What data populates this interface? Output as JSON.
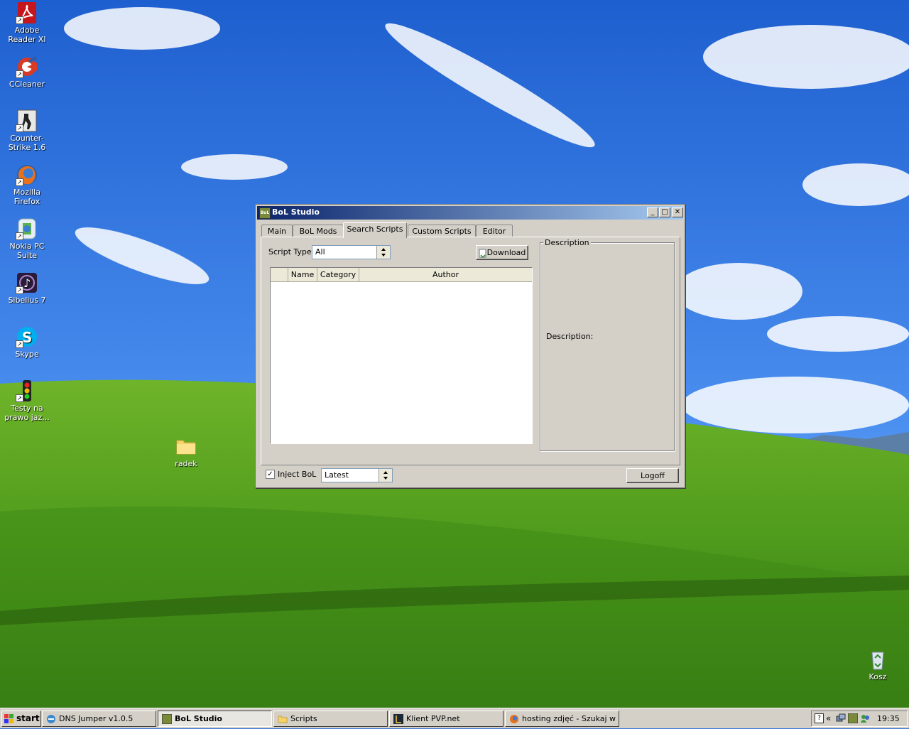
{
  "desktop": {
    "icons": [
      {
        "label": "Adobe Reader XI"
      },
      {
        "label": "CCleaner"
      },
      {
        "label": "Counter-Strike 1.6"
      },
      {
        "label": "Mozilla Firefox"
      },
      {
        "label": "Nokia PC Suite"
      },
      {
        "label": "Sibelius 7"
      },
      {
        "label": "Skype"
      },
      {
        "label": "Testy na prawo jaz..."
      },
      {
        "label": "radek"
      },
      {
        "label": "Kosz"
      }
    ]
  },
  "window": {
    "title": "BoL Studio",
    "title_icon_text": "BoL",
    "controls": {
      "minimize": "_",
      "maximize": "□",
      "close": "✕"
    },
    "tabs": [
      {
        "label": "Main"
      },
      {
        "label": "BoL Mods"
      },
      {
        "label": "Search Scripts",
        "active": true
      },
      {
        "label": "Custom Scripts"
      },
      {
        "label": "Editor"
      }
    ],
    "script_type_label": "Script Type:",
    "script_type_value": "All",
    "download_label": "Download",
    "columns": [
      "",
      "Name",
      "Category",
      "Author"
    ],
    "description_group_label": "Description",
    "description_label": "Description:",
    "inject_label": "Inject BoL",
    "inject_checked": true,
    "version_value": "Latest",
    "logoff_label": "Logoff"
  },
  "taskbar": {
    "start_label": "start",
    "tasks": [
      {
        "label": "DNS Jumper v1.0.5"
      },
      {
        "label": "BoL Studio",
        "active": true
      },
      {
        "label": "Scripts"
      },
      {
        "label": "Klient PVP.net"
      },
      {
        "label": "hosting zdjęć - Szukaj w ..."
      }
    ],
    "clock": "19:35",
    "tray_expand": "«",
    "help_icon": "?"
  },
  "colors": {
    "title_bar_start": "#0a246a",
    "title_bar_end": "#a6caf0",
    "window_face": "#d4d0c8"
  }
}
